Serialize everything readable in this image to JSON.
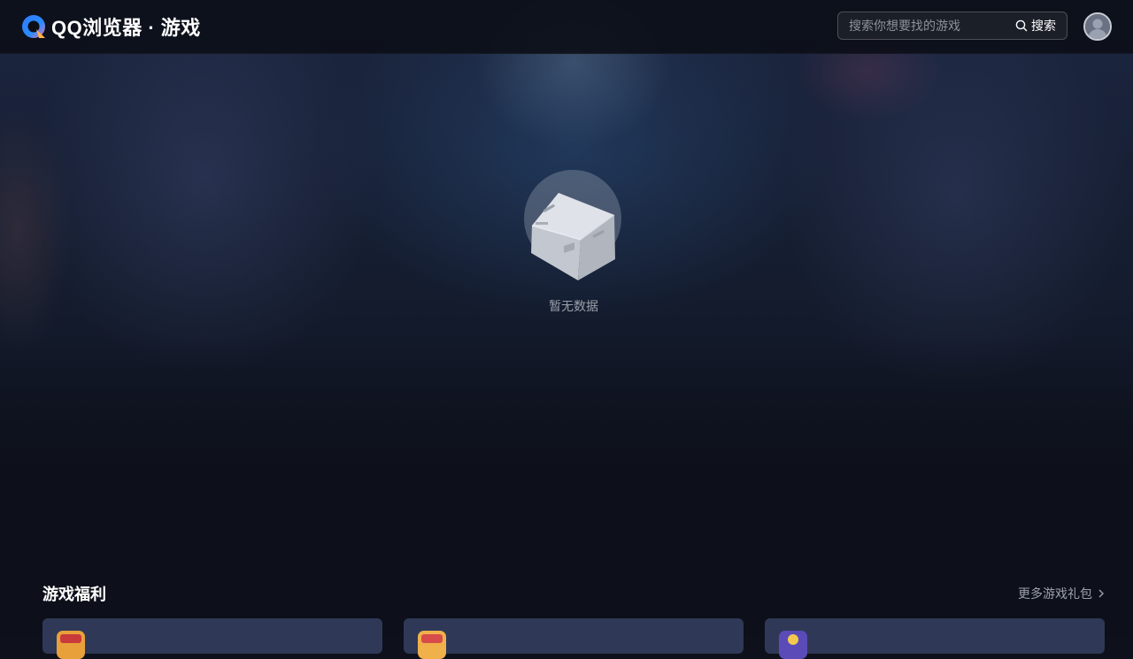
{
  "header": {
    "logo_text": "QQ浏览器 · 游戏",
    "search": {
      "placeholder": "搜索你想要找的游戏",
      "value": "",
      "button_label": "搜索"
    }
  },
  "main": {
    "empty_state": {
      "text": "暂无数据"
    }
  },
  "benefits": {
    "title": "游戏福利",
    "more_label": "更多游戏礼包",
    "cards": [
      {
        "icon": "game-icon"
      },
      {
        "icon": "game-icon"
      },
      {
        "icon": "game-icon"
      }
    ]
  },
  "colors": {
    "header_bg": "#0c0f18",
    "page_bg": "#0d101a",
    "card_bg": "#2f3957",
    "muted_text": "#9aa0aa"
  }
}
